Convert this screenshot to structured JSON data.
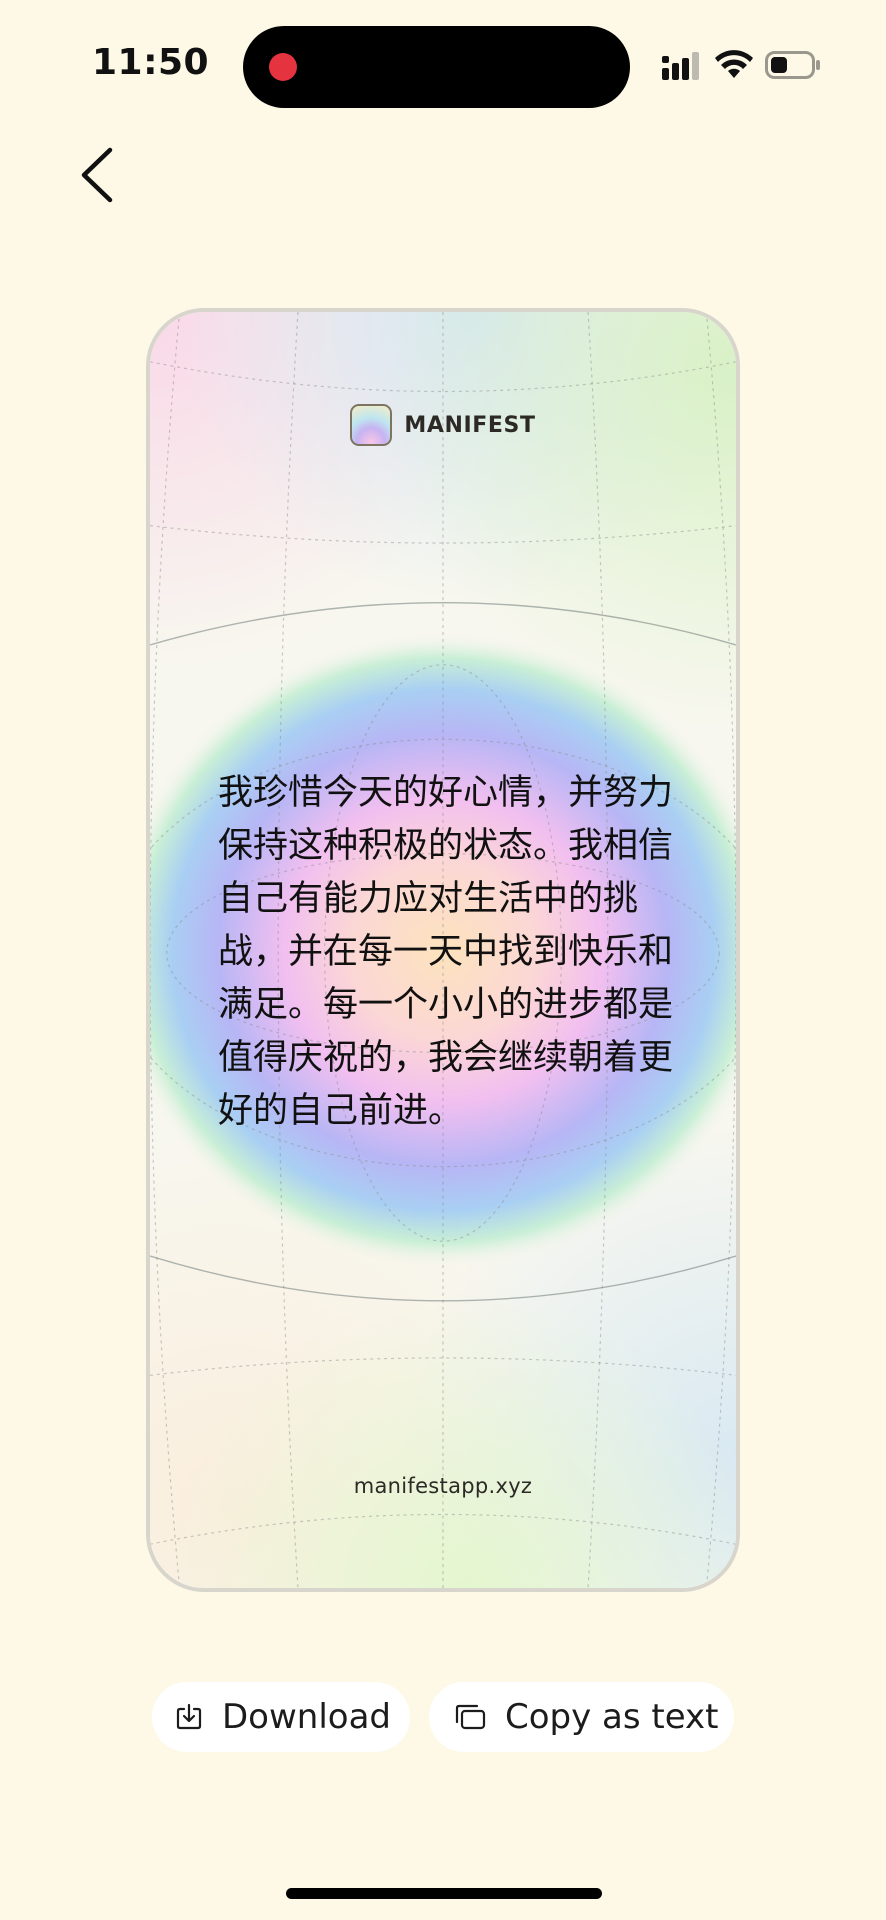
{
  "status_bar": {
    "time": "11:50"
  },
  "card": {
    "brand_name": "MANIFEST",
    "quote": "我珍惜今天的好心情，并努力保持这种积极的状态。我相信自己有能力应对生活中的挑战，并在每一天中找到快乐和满足。每一个小小的进步都是值得庆祝的，我会继续朝着更好的自己前进。",
    "website": "manifestapp.xyz"
  },
  "actions": {
    "download_label": "Download",
    "copy_label": "Copy as text"
  },
  "icons": {
    "back": "chevron-left-icon",
    "download": "download-icon",
    "copy": "copy-icon",
    "signal": "signal-icon",
    "wifi": "wifi-icon",
    "battery": "battery-icon"
  },
  "colors": {
    "background": "#fdf9e6",
    "record_dot": "#e5343f"
  }
}
